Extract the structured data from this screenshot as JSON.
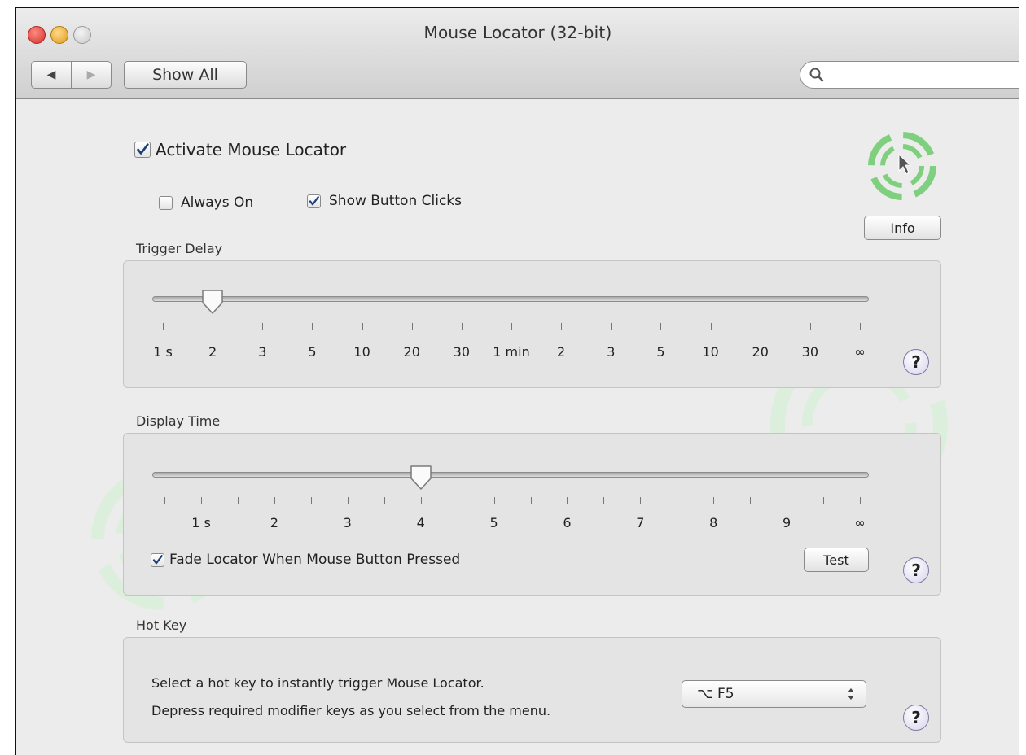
{
  "window": {
    "title": "Mouse Locator (32-bit)",
    "show_all": "Show All",
    "search": {
      "placeholder": "",
      "value": ""
    }
  },
  "activate": {
    "label": "Activate Mouse Locator",
    "checked": true
  },
  "always_on": {
    "label": "Always On",
    "checked": false
  },
  "show_clicks": {
    "label": "Show Button Clicks",
    "checked": true
  },
  "info_button": "Info",
  "trigger_delay": {
    "label": "Trigger Delay",
    "ticks": [
      "1 s",
      "2",
      "3",
      "5",
      "10",
      "20",
      "30",
      "1 min",
      "2",
      "3",
      "5",
      "10",
      "20",
      "30",
      "∞"
    ],
    "selected_index": 1
  },
  "display_time": {
    "label": "Display Time",
    "labels": [
      "1 s",
      "2",
      "3",
      "4",
      "5",
      "6",
      "7",
      "8",
      "9",
      "∞"
    ],
    "value": 4,
    "fade_label": "Fade Locator When Mouse Button Pressed",
    "fade_checked": true,
    "test_button": "Test"
  },
  "hot_key": {
    "label": "Hot Key",
    "line1": "Select a hot key to instantly trigger Mouse Locator.",
    "line2": "Depress required modifier keys as you select from the menu.",
    "selected": "⌥ F5"
  },
  "help": "?",
  "colors": {
    "accent_green": "#7ed07e",
    "checkmark": "#1a3f7a",
    "close": "#e0443e",
    "minimize": "#e8a82a"
  }
}
